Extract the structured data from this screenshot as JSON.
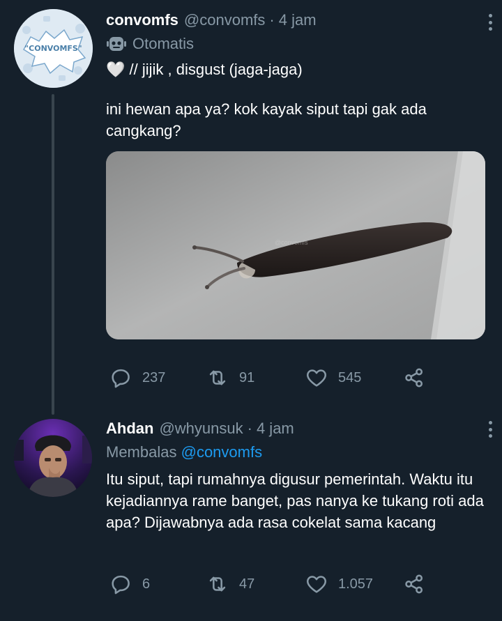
{
  "tweet1": {
    "avatar_label": "\"CONVOMFS\"",
    "name": "convomfs",
    "handle": "@convomfs",
    "separator": "·",
    "time": "4 jam",
    "automated_label": "Otomatis",
    "line1": "🤍 // jijik , disgust (jaga-jaga)",
    "body": "ini hewan apa ya? kok kayak siput tapi gak ada cangkang?",
    "media_watermark": "@convomfs",
    "stats": {
      "replies": "237",
      "retweets": "91",
      "likes": "545"
    }
  },
  "tweet2": {
    "name": "Ahdan",
    "handle": "@whyunsuk",
    "separator": "·",
    "time": "4 jam",
    "reply_prefix": "Membalas",
    "reply_mention": "@convomfs",
    "body": "Itu siput, tapi rumahnya digusur pemerintah. Waktu itu kejadiannya rame banget, pas nanya ke tukang roti ada apa? Dijawabnya ada rasa cokelat sama kacang",
    "stats": {
      "replies": "6",
      "retweets": "47",
      "likes": "1.057"
    }
  },
  "colors": {
    "background": "#15202b",
    "secondary_text": "#8899a6",
    "link": "#1d9bf0",
    "thread_line": "#38444d"
  },
  "icons": [
    "robot-icon",
    "more-icon",
    "reply-icon",
    "retweet-icon",
    "like-icon",
    "share-icon"
  ]
}
